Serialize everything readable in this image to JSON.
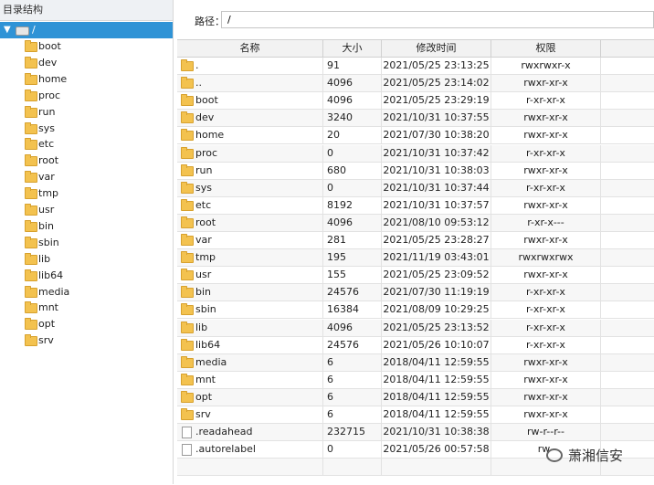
{
  "sidebar": {
    "header": "目录结构",
    "root_label": "/",
    "items": [
      "boot",
      "dev",
      "home",
      "proc",
      "run",
      "sys",
      "etc",
      "root",
      "var",
      "tmp",
      "usr",
      "bin",
      "sbin",
      "lib",
      "lib64",
      "media",
      "mnt",
      "opt",
      "srv"
    ]
  },
  "path": {
    "label": "路径：",
    "value": "/"
  },
  "table": {
    "columns": [
      "名称",
      "大小",
      "修改时间",
      "权限"
    ],
    "rows": [
      {
        "name": ".",
        "size": "91",
        "time": "2021/05/25 23:13:25",
        "perm": "rwxrwxr-x",
        "type": "folder"
      },
      {
        "name": "..",
        "size": "4096",
        "time": "2021/05/25 23:14:02",
        "perm": "rwxr-xr-x",
        "type": "folder"
      },
      {
        "name": "boot",
        "size": "4096",
        "time": "2021/05/25 23:29:19",
        "perm": "r-xr-xr-x",
        "type": "folder"
      },
      {
        "name": "dev",
        "size": "3240",
        "time": "2021/10/31 10:37:55",
        "perm": "rwxr-xr-x",
        "type": "folder"
      },
      {
        "name": "home",
        "size": "20",
        "time": "2021/07/30 10:38:20",
        "perm": "rwxr-xr-x",
        "type": "folder"
      },
      {
        "name": "proc",
        "size": "0",
        "time": "2021/10/31 10:37:42",
        "perm": "r-xr-xr-x",
        "type": "folder"
      },
      {
        "name": "run",
        "size": "680",
        "time": "2021/10/31 10:38:03",
        "perm": "rwxr-xr-x",
        "type": "folder"
      },
      {
        "name": "sys",
        "size": "0",
        "time": "2021/10/31 10:37:44",
        "perm": "r-xr-xr-x",
        "type": "folder"
      },
      {
        "name": "etc",
        "size": "8192",
        "time": "2021/10/31 10:37:57",
        "perm": "rwxr-xr-x",
        "type": "folder"
      },
      {
        "name": "root",
        "size": "4096",
        "time": "2021/08/10 09:53:12",
        "perm": "r-xr-x---",
        "type": "folder"
      },
      {
        "name": "var",
        "size": "281",
        "time": "2021/05/25 23:28:27",
        "perm": "rwxr-xr-x",
        "type": "folder"
      },
      {
        "name": "tmp",
        "size": "195",
        "time": "2021/11/19 03:43:01",
        "perm": "rwxrwxrwx",
        "type": "folder"
      },
      {
        "name": "usr",
        "size": "155",
        "time": "2021/05/25 23:09:52",
        "perm": "rwxr-xr-x",
        "type": "folder"
      },
      {
        "name": "bin",
        "size": "24576",
        "time": "2021/07/30 11:19:19",
        "perm": "r-xr-xr-x",
        "type": "folder"
      },
      {
        "name": "sbin",
        "size": "16384",
        "time": "2021/08/09 10:29:25",
        "perm": "r-xr-xr-x",
        "type": "folder"
      },
      {
        "name": "lib",
        "size": "4096",
        "time": "2021/05/25 23:13:52",
        "perm": "r-xr-xr-x",
        "type": "folder"
      },
      {
        "name": "lib64",
        "size": "24576",
        "time": "2021/05/26 10:10:07",
        "perm": "r-xr-xr-x",
        "type": "folder"
      },
      {
        "name": "media",
        "size": "6",
        "time": "2018/04/11 12:59:55",
        "perm": "rwxr-xr-x",
        "type": "folder"
      },
      {
        "name": "mnt",
        "size": "6",
        "time": "2018/04/11 12:59:55",
        "perm": "rwxr-xr-x",
        "type": "folder"
      },
      {
        "name": "opt",
        "size": "6",
        "time": "2018/04/11 12:59:55",
        "perm": "rwxr-xr-x",
        "type": "folder"
      },
      {
        "name": "srv",
        "size": "6",
        "time": "2018/04/11 12:59:55",
        "perm": "rwxr-xr-x",
        "type": "folder"
      },
      {
        "name": ".readahead",
        "size": "232715",
        "time": "2021/10/31 10:38:38",
        "perm": "rw-r--r--",
        "type": "file"
      },
      {
        "name": ".autorelabel",
        "size": "0",
        "time": "2021/05/26 00:57:58",
        "perm": "rw-",
        "type": "file"
      }
    ]
  },
  "watermark": {
    "text": "萧湘信安",
    "icon": "wechat-icon"
  },
  "colors": {
    "selection": "#2f93d6",
    "folder": "#f3c24f"
  }
}
